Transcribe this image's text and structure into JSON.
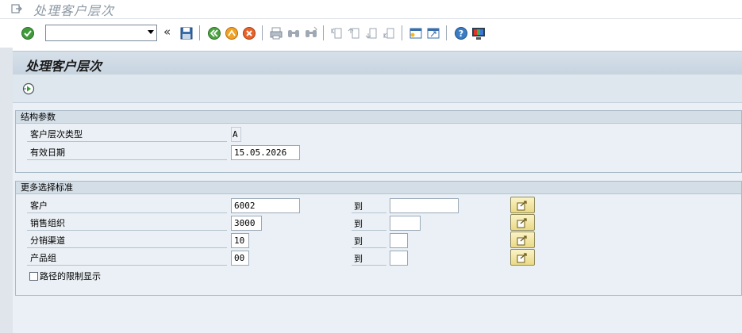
{
  "window": {
    "title": "处理客户层次"
  },
  "toolbar": {
    "command_field_value": "",
    "back_label": "«",
    "icons": [
      "enter-icon",
      "save-icon",
      "back-icon",
      "exit-icon",
      "cancel-icon",
      "print-icon",
      "find-icon",
      "find-next-icon",
      "first-page-icon",
      "prev-page-icon",
      "next-page-icon",
      "last-page-icon",
      "new-session-icon",
      "shortcut-icon",
      "help-icon",
      "layout-icon"
    ]
  },
  "screen": {
    "title": "处理客户层次",
    "execute_icon": "execute-icon"
  },
  "structure_params": {
    "title": "结构参数",
    "hierarchy_type_label": "客户层次类型",
    "hierarchy_type_value": "A",
    "valid_date_label": "有效日期",
    "valid_date_value": "15.05.2026"
  },
  "more_criteria": {
    "title": "更多选择标准",
    "to_label": "到",
    "rows": [
      {
        "label": "客户",
        "from": "6002",
        "to": ""
      },
      {
        "label": "销售组织",
        "from": "3000",
        "to": ""
      },
      {
        "label": "分销渠道",
        "from": "10",
        "to": ""
      },
      {
        "label": "产品组",
        "from": "00",
        "to": ""
      }
    ],
    "path_limit_label": "路径的限制显示",
    "path_limit_checked": false
  },
  "colors": {
    "panel_bg": "#eaf0f5",
    "group_title_bg": "#d4dee7",
    "multi_button": "#ead985"
  }
}
